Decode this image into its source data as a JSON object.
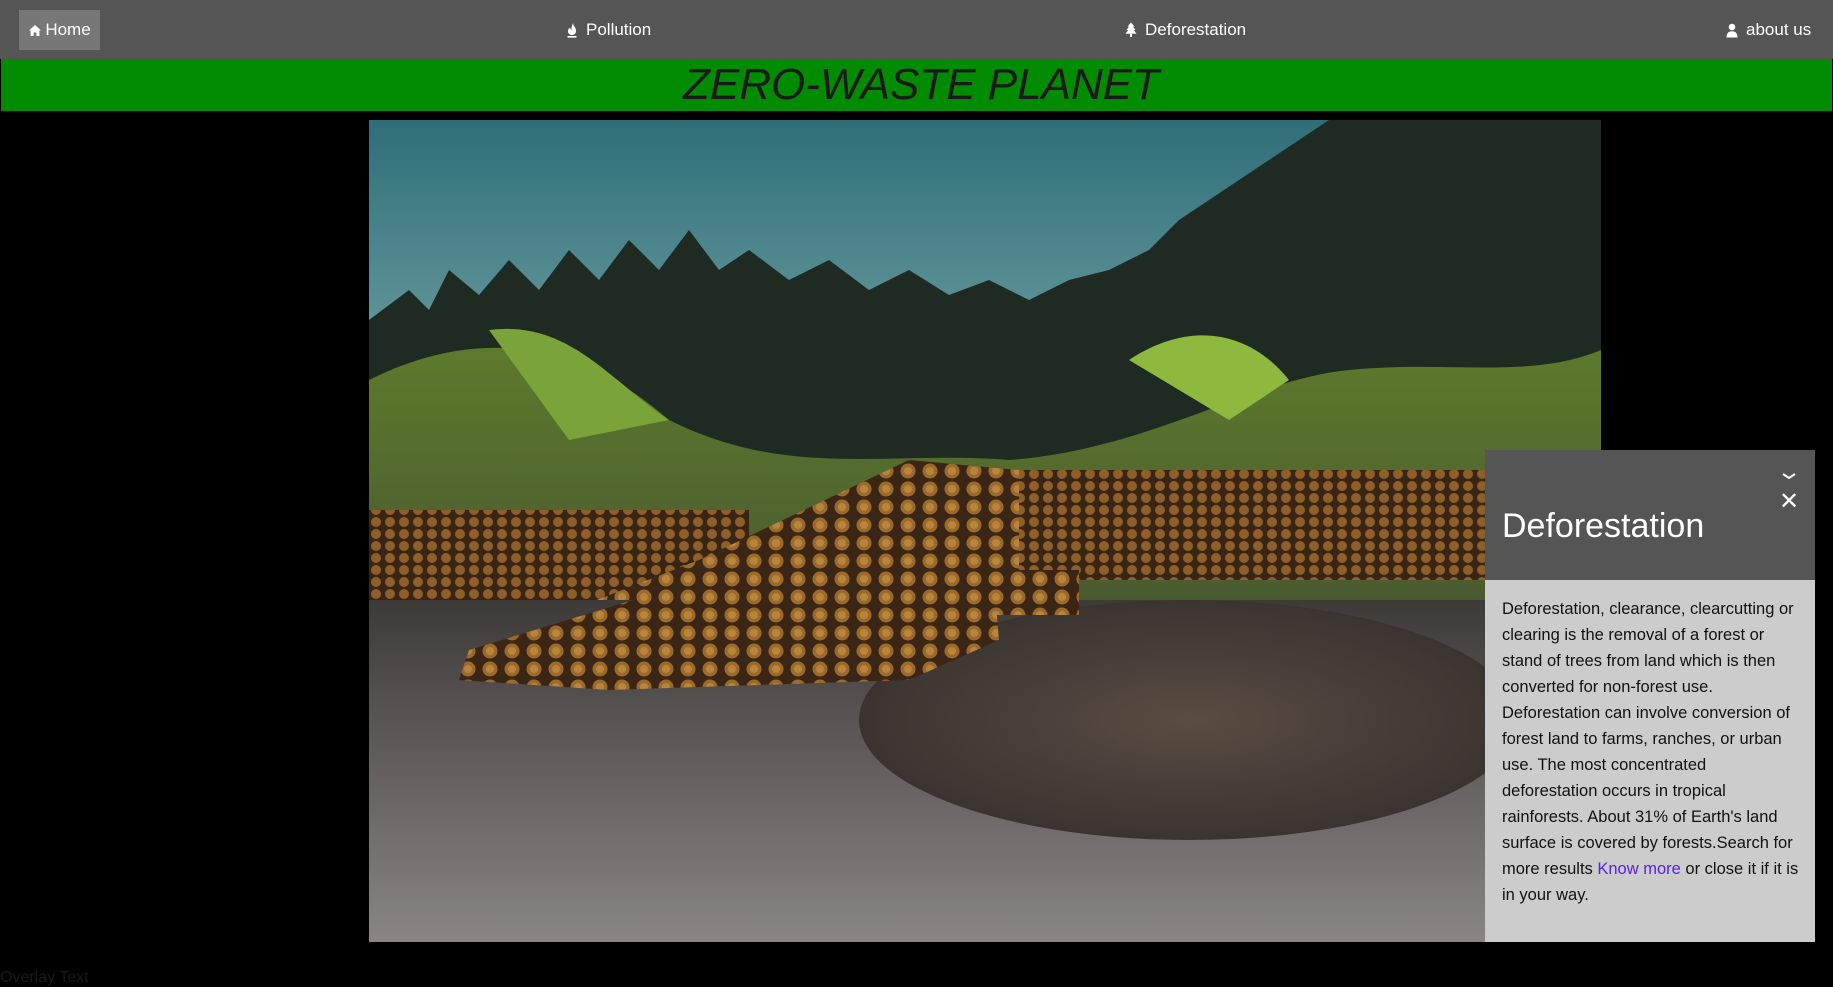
{
  "nav": {
    "home_label": "Home",
    "pollution_label": "Pollution",
    "deforestation_label": "Deforestation",
    "about_label": "about us"
  },
  "banner": {
    "title": "ZERO-WASTE PLANET"
  },
  "popup": {
    "title": "Deforestation",
    "close_symbol": "✕",
    "body_text": "Deforestation, clearance, clearcutting or clearing is the removal of a forest or stand of trees from land which is then converted for non-forest use. Deforestation can involve conversion of forest land to farms, ranches, or urban use. The most concentrated deforestation occurs in tropical rainforests. About 31% of Earth's land surface is covered by forests.Search for more results",
    "link_label": "Know more",
    "body_tail": "or close it if it is in your way."
  },
  "overlay": {
    "text": "Overlay Text"
  },
  "colors": {
    "navbar_bg": "#555555",
    "banner_green": "#008b00",
    "link_purple": "#5b1fe6",
    "popup_bg": "#cccccc"
  },
  "icons": {
    "home": "home-icon",
    "pollution": "fire-icon",
    "deforestation": "tree-icon",
    "about": "user-icon"
  }
}
